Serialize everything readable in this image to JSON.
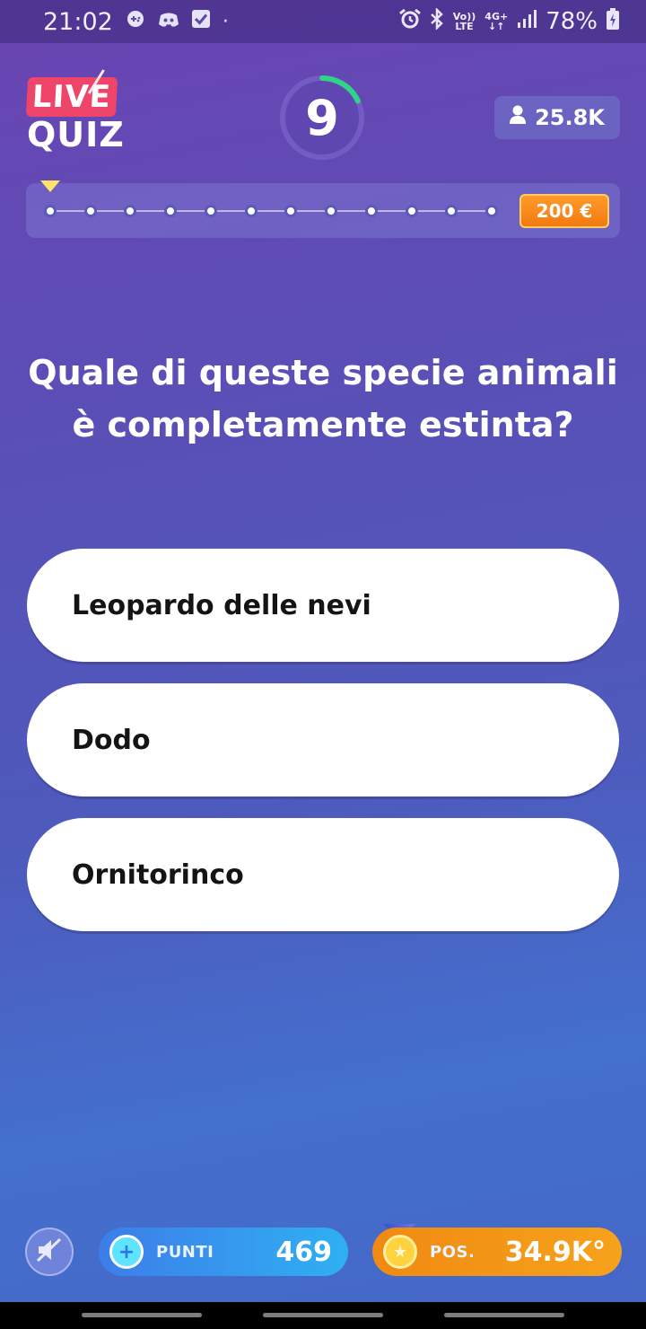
{
  "status_bar": {
    "time": "21:02",
    "left_icons": [
      "game-controller-icon",
      "discord-icon",
      "checkbox-icon",
      "dot-icon"
    ],
    "right_icons": [
      "alarm-icon",
      "bluetooth-icon",
      "volte-icon",
      "4g-icon",
      "signal-icon"
    ],
    "volte_line1": "Vo))",
    "volte_line2": "LTE",
    "net_line1": "4G+",
    "net_line2": "↓↑",
    "battery": "78%"
  },
  "header": {
    "logo_top": "LIVE",
    "logo_bottom": "QUIZ",
    "timer_value": "9",
    "timer_progress": 0.18,
    "viewers": "25.8K"
  },
  "ladder": {
    "steps": 12,
    "current_step": 1,
    "prize": "200 €"
  },
  "question": {
    "text": "Quale di queste specie animali è completamente estinta?"
  },
  "answers": [
    {
      "label": "Leopardo delle nevi"
    },
    {
      "label": "Dodo"
    },
    {
      "label": "Ornitorinco"
    }
  ],
  "footer": {
    "points_label": "PUNTI",
    "points_value": "469",
    "pos_label": "POS.",
    "pos_value": "34.9K°"
  },
  "colors": {
    "accent_live": "#f0456b",
    "timer_ring": "#2fd48a",
    "prize": "#f27a10",
    "points": "#2fb0f2",
    "pos": "#f6a21c"
  }
}
